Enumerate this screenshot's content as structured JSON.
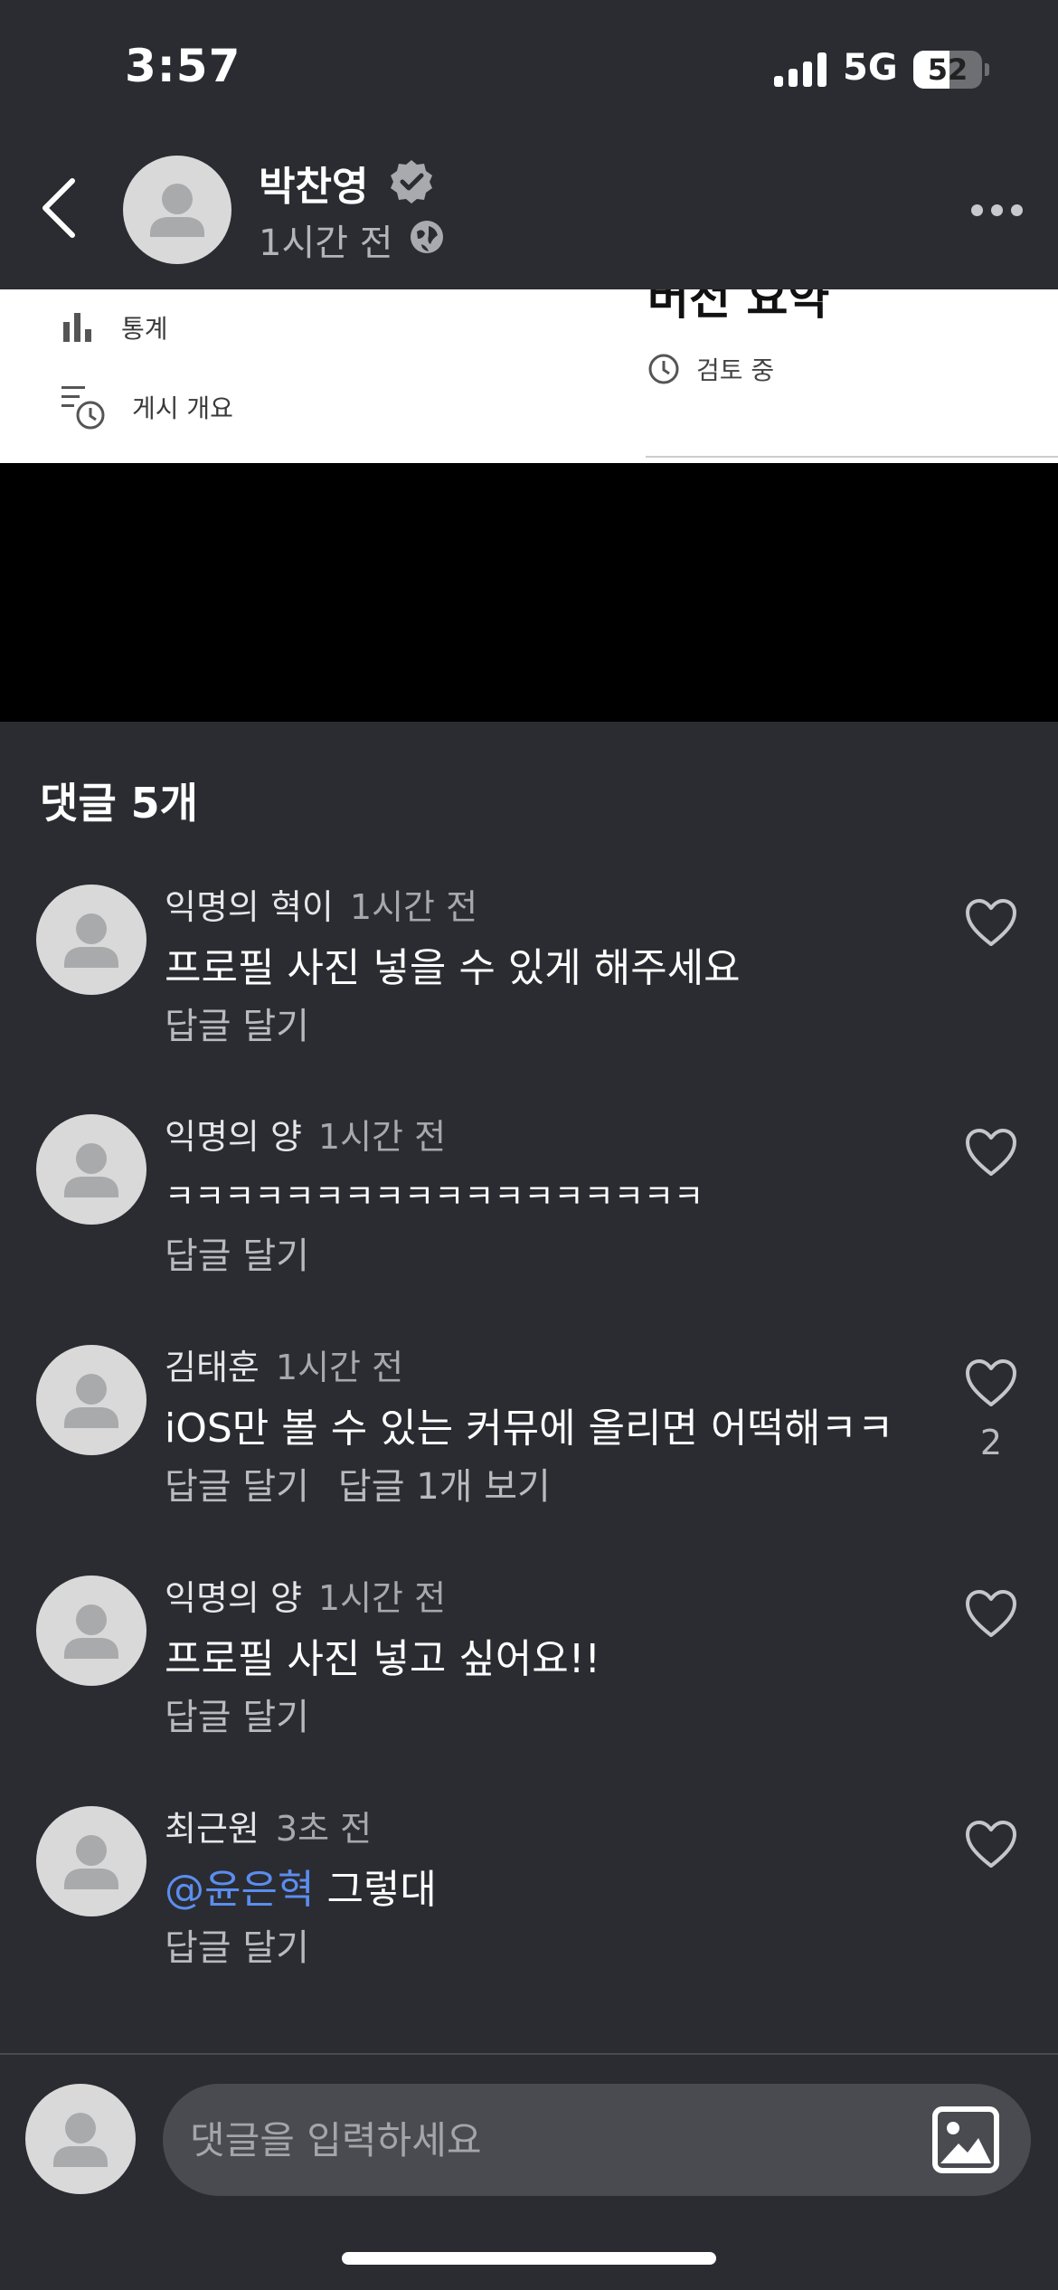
{
  "status_bar": {
    "time": "3:57",
    "network": "5G",
    "battery_percent": 52,
    "battery_label": "52"
  },
  "header": {
    "author": "박찬영",
    "time": "1시간 전"
  },
  "embed": {
    "rows": [
      {
        "label": "통계"
      },
      {
        "label": "게시 개요"
      }
    ],
    "title": "버전 요약",
    "status": "검토 중"
  },
  "comments_title": "댓글 5개",
  "comments": [
    {
      "author": "익명의 혁이",
      "time": "1시간 전",
      "text": "프로필 사진 넣을 수 있게 해주세요",
      "actions": [
        "답글 달기"
      ],
      "likes": ""
    },
    {
      "author": "익명의 양",
      "time": "1시간 전",
      "text": "ㅋㅋㅋㅋㅋㅋㅋㅋㅋㅋㅋㅋㅋㅋㅋㅋㅋㅋ",
      "actions": [
        "답글 달기"
      ],
      "likes": ""
    },
    {
      "author": "김태훈",
      "time": "1시간 전",
      "text": "iOS만 볼 수 있는 커뮤에 올리면 어떡해ㅋㅋ",
      "actions": [
        "답글 달기",
        "답글 1개 보기"
      ],
      "likes": "2"
    },
    {
      "author": "익명의 양",
      "time": "1시간 전",
      "text": "프로필 사진 넣고 싶어요!!",
      "actions": [
        "답글 달기"
      ],
      "likes": ""
    },
    {
      "author": "최근원",
      "time": "3초 전",
      "mention": "@윤은혁",
      "text": " 그렇대",
      "actions": [
        "답글 달기"
      ],
      "likes": ""
    }
  ],
  "input": {
    "placeholder": "댓글을 입력하세요",
    "value": ""
  },
  "colors": {
    "background": "#2b2c31",
    "mention": "#5b8def",
    "input_bg": "#4a4b50"
  }
}
